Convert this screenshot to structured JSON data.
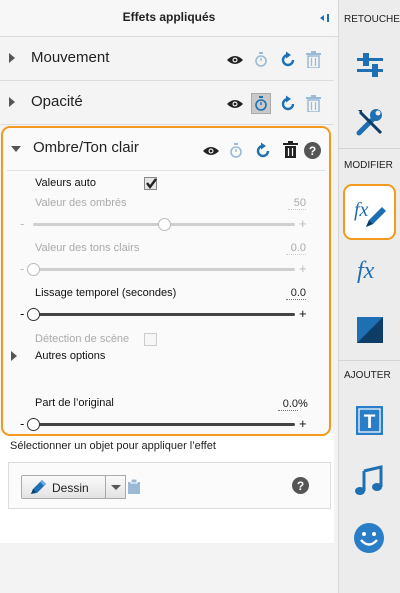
{
  "header": {
    "title": "Effets appliqués"
  },
  "effects": [
    {
      "label": "Mouvement"
    },
    {
      "label": "Opacité"
    }
  ],
  "ombre": {
    "label": "Ombre/Ton clair",
    "valeurs_auto": {
      "label": "Valeurs auto",
      "checked": true
    },
    "ombres": {
      "label": "Valeur des ombrés",
      "value": "50",
      "level": 0.5
    },
    "tons_clairs": {
      "label": "Valeur des tons clairs",
      "value": "0.0",
      "level": 0.0
    },
    "lissage": {
      "label": "Lissage temporel (secondes)",
      "value": "0.0",
      "level": 0.0
    },
    "detection": {
      "label": "Détection de scène",
      "checked": false
    },
    "autres": {
      "label": "Autres options"
    },
    "part": {
      "label": "Part de l’original",
      "value": "0.0",
      "unit": "%",
      "level": 0.0
    },
    "minus": "-",
    "plus": "+"
  },
  "select_hint": "Sélectionner un objet pour appliquer l’effet",
  "dessin": {
    "label": "Dessin"
  },
  "rail": {
    "retouche": "RETOUCHE",
    "modifier": "MODIFIER",
    "ajouter": "AJOUTER"
  },
  "colors": {
    "accent_orange": "#f39a1e",
    "icon_blue": "#1f6fb3",
    "text_blue": "#2a7ec8"
  }
}
